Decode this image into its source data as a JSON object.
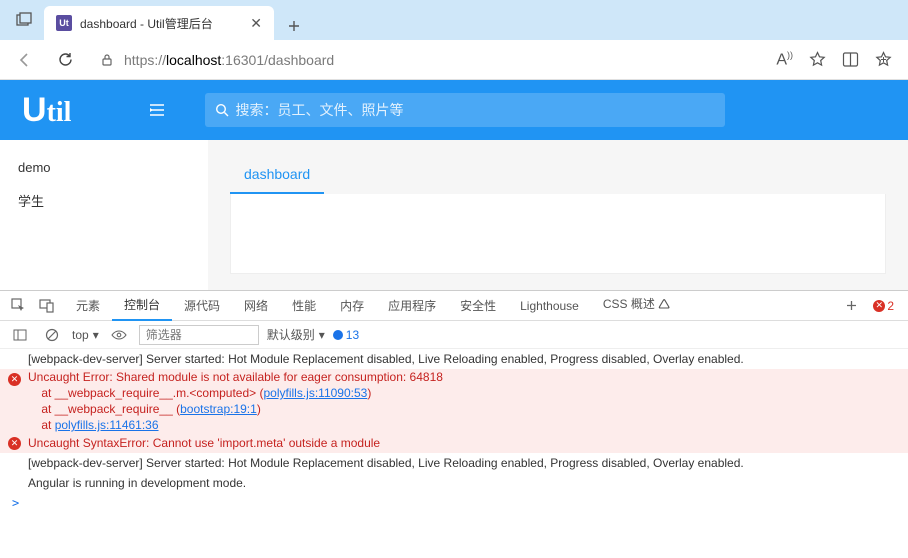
{
  "browser": {
    "tab_title": "dashboard - Util管理后台",
    "url_prefix": "https://",
    "url_host": "localhost",
    "url_port_path": ":16301/dashboard"
  },
  "app": {
    "logo_text": "Util",
    "search_placeholder": "搜索：员工、文件、照片等"
  },
  "sidebar": {
    "items": [
      "demo",
      "学生"
    ]
  },
  "content": {
    "tab_label": "dashboard"
  },
  "devtools": {
    "tabs": [
      "元素",
      "控制台",
      "源代码",
      "网络",
      "性能",
      "内存",
      "应用程序",
      "安全性",
      "Lighthouse",
      "CSS 概述 🛆"
    ],
    "active_tab": 1,
    "err_count": "2",
    "context": "top",
    "filter_placeholder": "筛选器",
    "level": "默认级别",
    "msg_count": "13"
  },
  "console": {
    "log1": "[webpack-dev-server] Server started: Hot Module Replacement disabled, Live Reloading enabled, Progress disabled, Overlay enabled.",
    "err1_l1": "Uncaught Error: Shared module is not available for eager consumption: 64818",
    "err1_l2a": "    at __webpack_require__.m.<computed> (",
    "err1_l2b": "polyfills.js:11090:53",
    "err1_l2c": ")",
    "err1_l3a": "    at __webpack_require__ (",
    "err1_l3b": "bootstrap:19:1",
    "err1_l3c": ")",
    "err1_l4a": "    at ",
    "err1_l4b": "polyfills.js:11461:36",
    "err2": "Uncaught SyntaxError: Cannot use 'import.meta' outside a module",
    "log2": "[webpack-dev-server] Server started: Hot Module Replacement disabled, Live Reloading enabled, Progress disabled, Overlay enabled.",
    "log3": "Angular is running in development mode.",
    "prompt": ">"
  }
}
